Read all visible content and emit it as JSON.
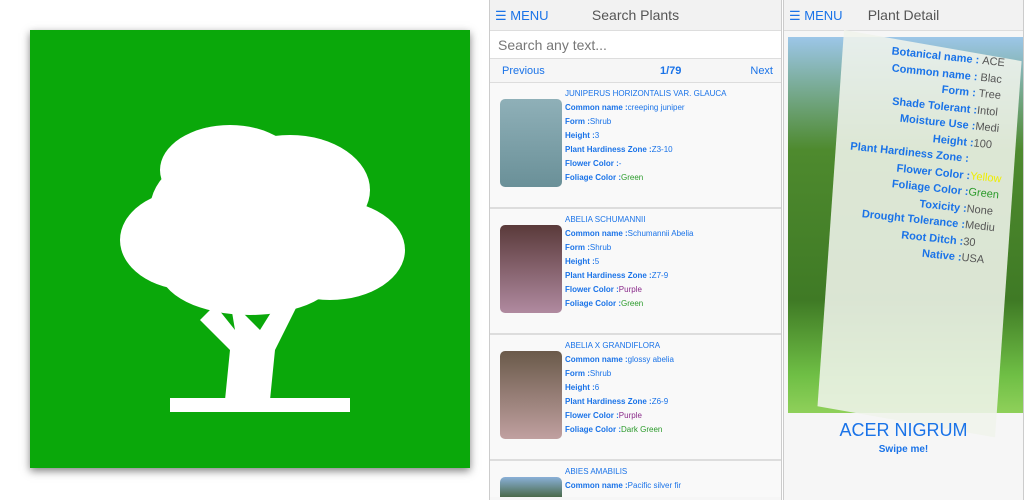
{
  "logo": {
    "icon": "tree-icon",
    "bg": "#0aa80a"
  },
  "search_screen": {
    "menu": "MENU",
    "title": "Search Plants",
    "search_placeholder": "Search any text...",
    "previous": "Previous",
    "page": "1/79",
    "next": "Next",
    "labels": {
      "common": "Common name :",
      "form": "Form :",
      "height": "Height :",
      "zone": "Plant Hardiness Zone :",
      "flower": "Flower Color :",
      "foliage": "Foliage Color :"
    },
    "items": [
      {
        "name": "JUNIPERUS HORIZONTALIS VAR. GLAUCA",
        "common": "creeping juniper",
        "form": "Shrub",
        "height": "3",
        "zone": "Z3-10",
        "flower": "-",
        "foliage": "Green"
      },
      {
        "name": "ABELIA SCHUMANNII",
        "common": "Schumannii Abelia",
        "form": "Shrub",
        "height": "5",
        "zone": "Z7-9",
        "flower": "Purple",
        "foliage": "Green"
      },
      {
        "name": "ABELIA X GRANDIFLORA",
        "common": "glossy abelia",
        "form": "Shrub",
        "height": "6",
        "zone": "Z6-9",
        "flower": "Purple",
        "foliage": "Dark Green"
      },
      {
        "name": "ABIES AMABILIS",
        "common": "Pacific silver fir"
      }
    ]
  },
  "detail_screen": {
    "menu": "MENU",
    "title": "Plant Detail",
    "plant_name": "ACER NIGRUM",
    "swipe": "Swipe me!",
    "rows": [
      {
        "k": "Botanical name : ",
        "v": "ACE"
      },
      {
        "k": "Common name : ",
        "v": "Blac"
      },
      {
        "k": "Form : ",
        "v": "Tree"
      },
      {
        "k": "Shade Tolerant :",
        "v": "Intol"
      },
      {
        "k": "Moisture Use :",
        "v": "Medi"
      },
      {
        "k": "Height :",
        "v": "100"
      },
      {
        "k": "Plant Hardiness Zone : ",
        "v": ""
      },
      {
        "k": "Flower Color :",
        "v": "Yellow"
      },
      {
        "k": "Foliage Color :",
        "v": "Green"
      },
      {
        "k": "Toxicity :",
        "v": "None"
      },
      {
        "k": "Drought Tolerance :",
        "v": "Mediu"
      },
      {
        "k": "Root Ditch :",
        "v": "30"
      },
      {
        "k": "Native :",
        "v": "USA"
      }
    ]
  }
}
